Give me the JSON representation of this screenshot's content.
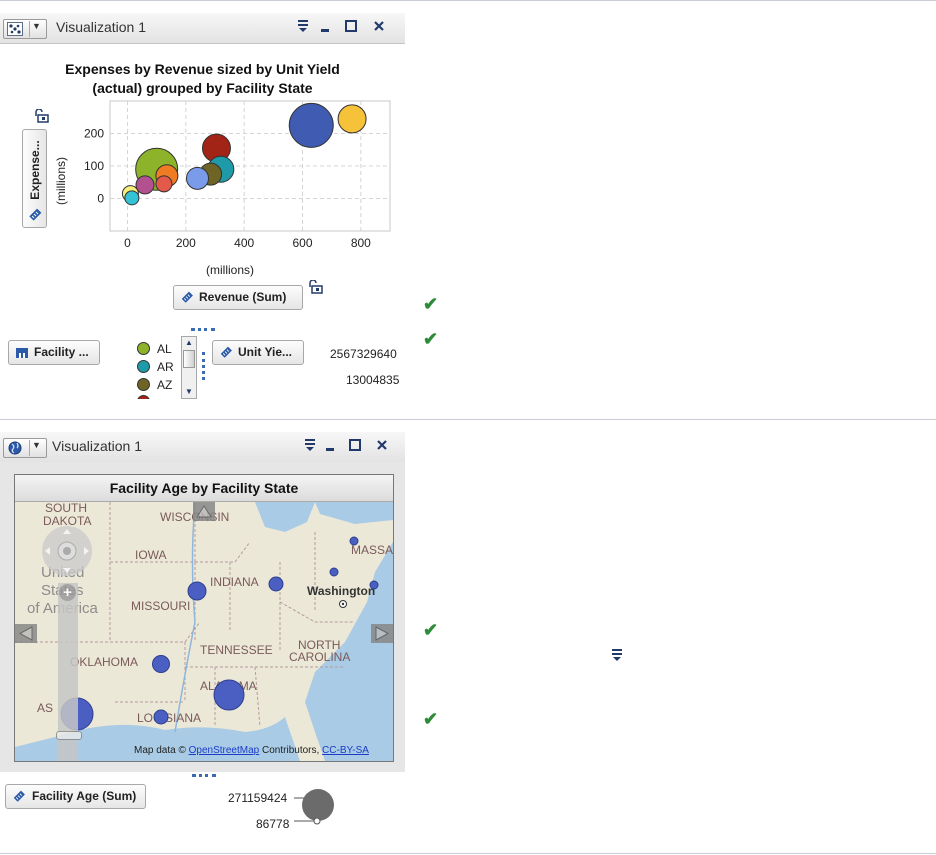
{
  "panel1": {
    "title": "Visualization 1",
    "chart_title_line1": "Expenses by Revenue sized by Unit Yield",
    "chart_title_line2": "(actual) grouped by Facility State",
    "y_role_label": "Expense...",
    "y_unit": "(millions)",
    "x_unit": "(millions)",
    "x_role_label": "Revenue (Sum)",
    "group_role_label": "Facility ...",
    "size_role_label": "Unit Yie...",
    "size_legend_max": "2567329640",
    "size_legend_min": "13004835",
    "legend": [
      {
        "label": "AL",
        "color": "#8cb32a"
      },
      {
        "label": "AR",
        "color": "#1f9aa8"
      },
      {
        "label": "AZ",
        "color": "#6e6425"
      }
    ],
    "chart_data": {
      "type": "scatter",
      "title": "Expenses by Revenue sized by Unit Yield (actual) grouped by Facility State",
      "xlabel": "(millions)",
      "ylabel": "Expense... (millions)",
      "xlim": [
        -60,
        900
      ],
      "ylim": [
        -100,
        300
      ],
      "x_ticks": [
        0,
        200,
        400,
        600,
        800
      ],
      "y_ticks": [
        0,
        100,
        200
      ],
      "grid": true,
      "points": [
        {
          "x": 630,
          "y": 225,
          "size": 22,
          "color": "#3f5bb2"
        },
        {
          "x": 770,
          "y": 245,
          "size": 14,
          "color": "#f5c23a"
        },
        {
          "x": 100,
          "y": 90,
          "size": 21,
          "color": "#8cb32a"
        },
        {
          "x": 305,
          "y": 155,
          "size": 14,
          "color": "#a12416"
        },
        {
          "x": 320,
          "y": 90,
          "size": 13,
          "color": "#1f9aa8"
        },
        {
          "x": 285,
          "y": 75,
          "size": 11,
          "color": "#6e6425"
        },
        {
          "x": 240,
          "y": 62,
          "size": 11,
          "color": "#7a9bea"
        },
        {
          "x": 135,
          "y": 70,
          "size": 11,
          "color": "#ef7b22"
        },
        {
          "x": 125,
          "y": 45,
          "size": 8,
          "color": "#e45a4a"
        },
        {
          "x": 60,
          "y": 42,
          "size": 9,
          "color": "#b3508f"
        },
        {
          "x": 10,
          "y": 15,
          "size": 8,
          "color": "#f6ef7b"
        },
        {
          "x": 15,
          "y": 2,
          "size": 7,
          "color": "#34c3d6"
        }
      ]
    }
  },
  "panel2": {
    "title": "Visualization 1",
    "chart_title": "Facility Age by Facility State",
    "size_role_label": "Facility Age (Sum)",
    "size_legend_max": "271159424",
    "size_legend_min": "86778",
    "map_labels": {
      "south_dakota_1": "SOUTH",
      "south_dakota_2": "DAKOTA",
      "wisconsin": "WISCONSIN",
      "iowa": "IOWA",
      "united_1": "United",
      "united_2": "States",
      "united_3": "of America",
      "indiana": "INDIANA",
      "missouri": "MISSOURI",
      "washington": "Washington",
      "massachusetts": "MASSAC",
      "oklahoma": "OKLAHOMA",
      "tennessee": "TENNESSEE",
      "north_carolina_1": "NORTH",
      "north_carolina_2": "CAROLINA",
      "alabama": "ALABAMA",
      "louisiana": "LOUISIANA",
      "texas": "AS",
      "attribution_prefix": "Map data ©",
      "attribution_link1": "OpenStreetMap",
      "attribution_mid": "Contributors,",
      "attribution_link2": "CC-BY-SA"
    },
    "bubble_color": "#4a5fc1"
  },
  "side": {
    "check_icons": 4,
    "menu_icon": "menu-icon"
  }
}
